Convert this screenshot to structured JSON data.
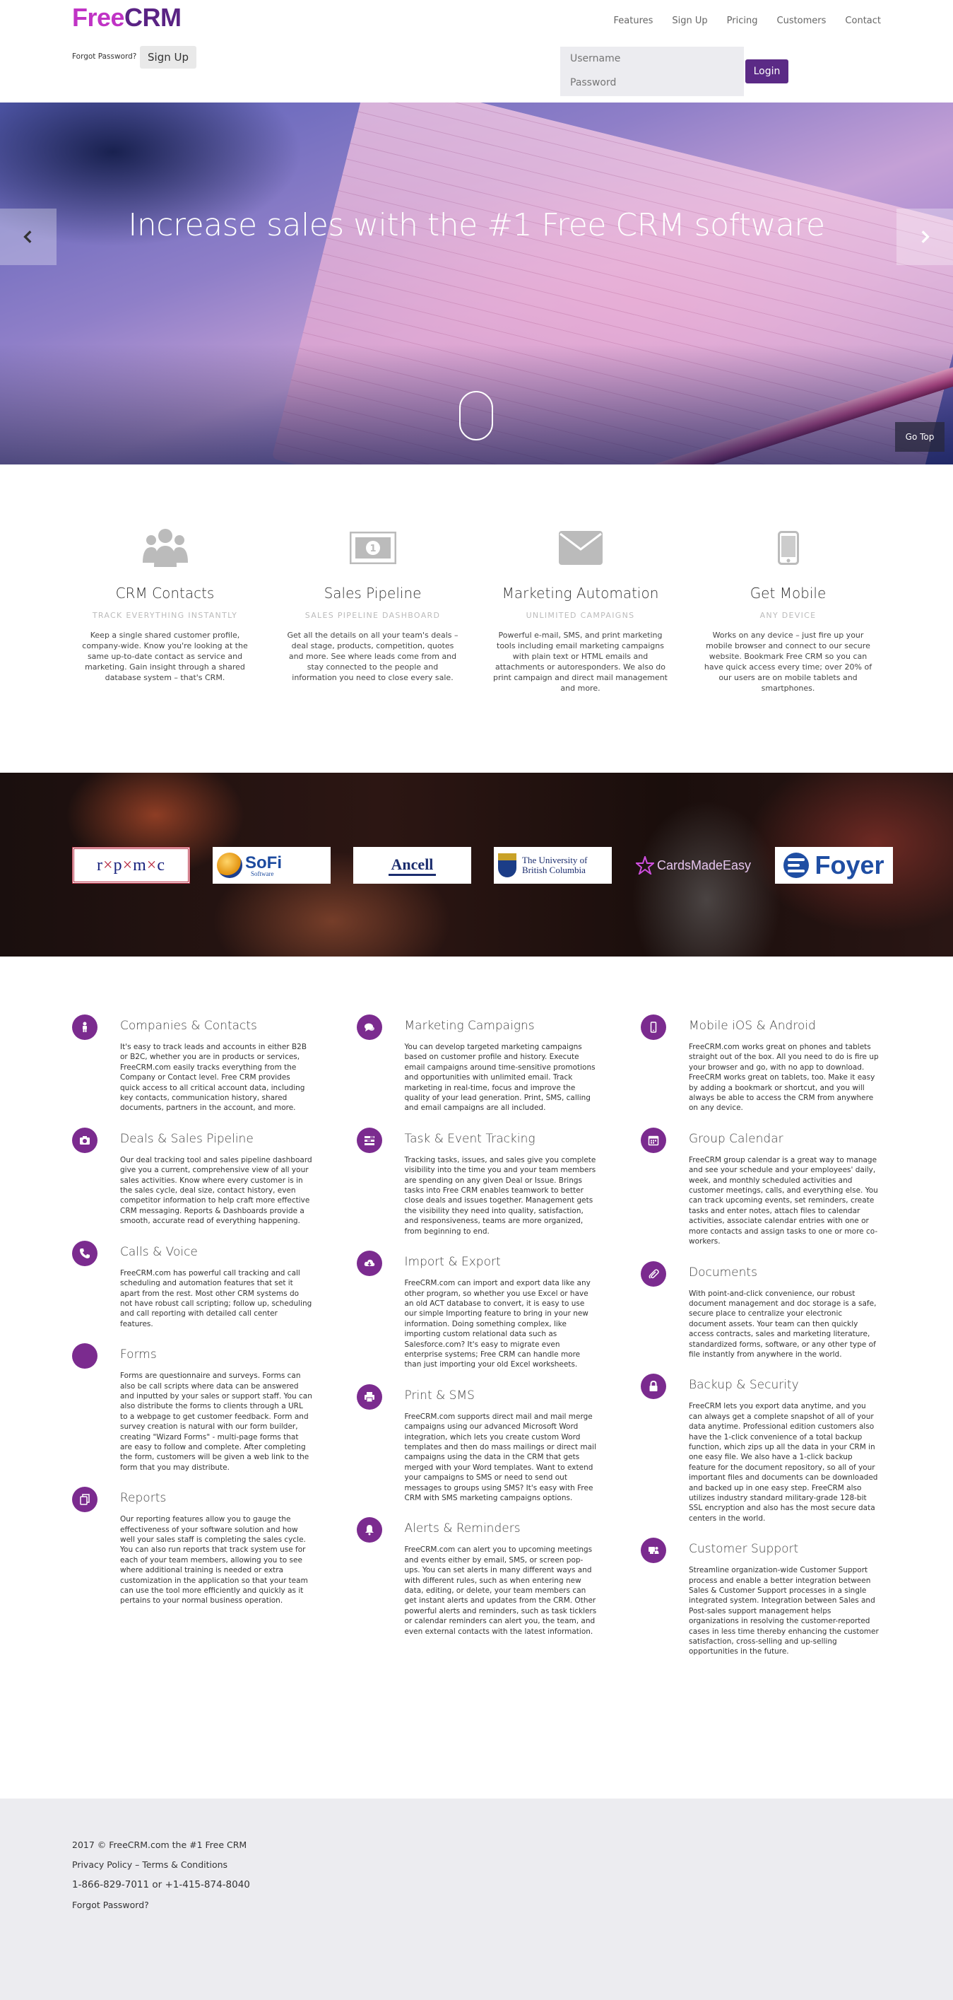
{
  "header": {
    "logo_free": "Free",
    "logo_crm": "CRM",
    "nav": [
      "Features",
      "Sign Up",
      "Pricing",
      "Customers",
      "Contact"
    ],
    "forgot_password": "Forgot Password?",
    "signup_label": "Sign Up",
    "username_placeholder": "Username",
    "password_placeholder": "Password",
    "login_label": "Login"
  },
  "hero": {
    "title": "Increase sales with the #1 Free CRM software",
    "go_top": "Go Top"
  },
  "features": [
    {
      "icon": "users-icon",
      "title": "CRM Contacts",
      "subtitle": "TRACK EVERYTHING INSTANTLY",
      "text": "Keep a single shared customer profile, company-wide. Know you're looking at the same up-to-date contact as service and marketing. Gain insight through a shared database system – that's CRM."
    },
    {
      "icon": "money-icon",
      "title": "Sales Pipeline",
      "subtitle": "SALES PIPELINE DASHBOARD",
      "text": "Get all the details on all your team's deals – deal stage, products, competition, quotes and more. See where leads come from and stay connected to the people and information you need to close every sale."
    },
    {
      "icon": "envelope-icon",
      "title": "Marketing Automation",
      "subtitle": "UNLIMITED CAMPAIGNS",
      "text": "Powerful e-mail, SMS, and print marketing tools including email marketing campaigns with plain text or HTML emails and attachments or autoresponders. We also do print campaign and direct mail management and more."
    },
    {
      "icon": "mobile-icon",
      "title": "Get Mobile",
      "subtitle": "ANY DEVICE",
      "text": "Works on any device – just fire up your mobile browser and connect to our secure website. Bookmark Free CRM so you can have quick access every time; over 20% of our users are on mobile tablets and smartphones."
    }
  ],
  "logos": {
    "rpmc": [
      "r",
      "p",
      "m",
      "c"
    ],
    "sofi": "SoFi",
    "sofi_sub": "Software",
    "ancell": "Ancell",
    "ubc_line1": "The University of",
    "ubc_line2": "British Columbia",
    "cards": "CardsMadeEasy",
    "foyer": "Foyer"
  },
  "details": {
    "col1": [
      {
        "icon": "person-icon",
        "title": "Companies & Contacts",
        "text": "It's easy to track leads and accounts in either B2B or B2C, whether you are in products or services, FreeCRM.com easily tracks everything from the Company or Contact level. Free CRM provides quick access to all critical account data, including key contacts, communication history, shared documents, partners in the account, and more."
      },
      {
        "icon": "camera-icon",
        "title": "Deals & Sales Pipeline",
        "text": "Our deal tracking tool and sales pipeline dashboard give you a current, comprehensive view of all your sales activities. Know where every customer is in the sales cycle, deal size, contact history, even competitor information to help craft more effective CRM messaging. Reports & Dashboards provide a smooth, accurate read of everything happening."
      },
      {
        "icon": "phone-icon",
        "title": "Calls & Voice",
        "text": "FreeCRM.com has powerful call tracking and call scheduling and automation features that set it apart from the rest. Most other CRM systems do not have robust call scripting; follow up, scheduling and call reporting with detailed call center features."
      },
      {
        "icon": "forms-icon",
        "title": "Forms",
        "text": "Forms are questionnaire and surveys. Forms can also be call scripts where data can be answered and inputted by your sales or support staff. You can also distribute the forms to clients through a URL to a webpage to get customer feedback. Form and survey creation is natural with our form builder, creating \"Wizard Forms\" - multi-page forms that are easy to follow and complete. After completing the form, customers will be given a web link to the form that you may distribute."
      },
      {
        "icon": "copy-icon",
        "title": "Reports",
        "text": "Our reporting features allow you to gauge the effectiveness of your software solution and how well your sales staff is completing the sales cycle. You can also run reports that track system use for each of your team members, allowing you to see where additional training is needed or extra customization in the application so that your team can use the tool more efficiently and quickly as it pertains to your normal business operation."
      }
    ],
    "col2": [
      {
        "icon": "comments-icon",
        "title": "Marketing Campaigns",
        "text": "You can develop targeted marketing campaigns based on customer profile and history. Execute email campaigns around time-sensitive promotions and opportunities with unlimited email. Track marketing in real-time, focus and improve the quality of your lead generation. Print, SMS, calling and email campaigns are all included."
      },
      {
        "icon": "tasks-icon",
        "title": "Task & Event Tracking",
        "text": "Tracking tasks, issues, and sales give you complete visibility into the time you and your team members are spending on any given Deal or Issue. Brings tasks into Free CRM enables teamwork to better close deals and issues together. Management gets the visibility they need into quality, satisfaction, and responsiveness, teams are more organized, from beginning to end."
      },
      {
        "icon": "cloud-download-icon",
        "title": "Import & Export",
        "text": "FreeCRM.com can import and export data like any other program, so whether you use Excel or have an old ACT database to convert, it is easy to use our simple Importing feature to bring in your new information. Doing something complex, like importing custom relational data such as Salesforce.com? It's easy to migrate even enterprise systems; Free CRM can handle more than just importing your old Excel worksheets."
      },
      {
        "icon": "print-icon",
        "title": "Print & SMS",
        "text": "FreeCRM.com supports direct mail and mail merge campaigns using our advanced Microsoft Word integration, which lets you create custom Word templates and then do mass mailings or direct mail campaigns using the data in the CRM that gets merged with your Word templates. Want to extend your campaigns to SMS or need to send out messages to groups using SMS? It's easy with Free CRM with SMS marketing campaigns options."
      },
      {
        "icon": "bell-icon",
        "title": "Alerts & Reminders",
        "text": "FreeCRM.com can alert you to upcoming meetings and events either by email, SMS, or screen pop-ups. You can set alerts in many different ways and with different rules, such as when entering new data, editing, or delete, your team members can get instant alerts and updates from the CRM. Other powerful alerts and reminders, such as task ticklers or calendar reminders can alert you, the team, and even external contacts with the latest information."
      }
    ],
    "col3": [
      {
        "icon": "mobile-icon",
        "title": "Mobile iOS & Android",
        "text": "FreeCRM.com works great on phones and tablets straight out of the box. All you need to do is fire up your browser and go, with no app to download. FreeCRM works great on tablets, too. Make it easy by adding a bookmark or shortcut, and you will always be able to access the CRM from anywhere on any device."
      },
      {
        "icon": "calendar-icon",
        "title": "Group Calendar",
        "text": "FreeCRM group calendar is a great way to manage and see your schedule and your employees' daily, week, and monthly scheduled activities and customer meetings, calls, and everything else. You can track upcoming events, set reminders, create tasks and enter notes, attach files to calendar activities, associate calendar entries with one or more contacts and assign tasks to one or more co-workers."
      },
      {
        "icon": "paperclip-icon",
        "title": "Documents",
        "text": "With point-and-click convenience, our robust document management and doc storage is a safe, secure place to centralize your electronic document assets. Your team can then quickly access contracts, sales and marketing literature, standardized forms, software, or any other type of file instantly from anywhere in the world."
      },
      {
        "icon": "lock-icon",
        "title": "Backup & Security",
        "text": "FreeCRM lets you export data anytime, and you can always get a complete snapshot of all of your data anytime. Professional edition customers also have the 1-click convenience of a total backup function, which zips up all the data in your CRM in one easy file. We also have a 1-click backup feature for the document repository, so all of your important files and documents can be downloaded and backed up in one easy step. FreeCRM also utilizes industry standard military-grade 128-bit SSL encryption and also has the most secure data centers in the world."
      },
      {
        "icon": "support-icon",
        "title": "Customer Support",
        "text": "Streamline organization-wide Customer Support process and enable a better integration between Sales & Customer Support processes in a single integrated system. Integration between Sales and Post-sales support management helps organizations in resolving the customer-reported cases in less time thereby enhancing the customer satisfaction, cross-selling and up-selling opportunities in the future."
      }
    ]
  },
  "footer": {
    "copyright": "2017 © FreeCRM.com the #1 Free CRM",
    "privacy": "Privacy Policy",
    "separator": " – ",
    "terms": "Terms & Conditions",
    "phone": "1-866-829-7011 or +1-415-874-8040",
    "forgot": "Forgot Password?"
  },
  "colors": {
    "brand_purple": "#5b2a86",
    "brand_magenta": "#c033c5",
    "icon_purple": "#7b2b8f"
  }
}
